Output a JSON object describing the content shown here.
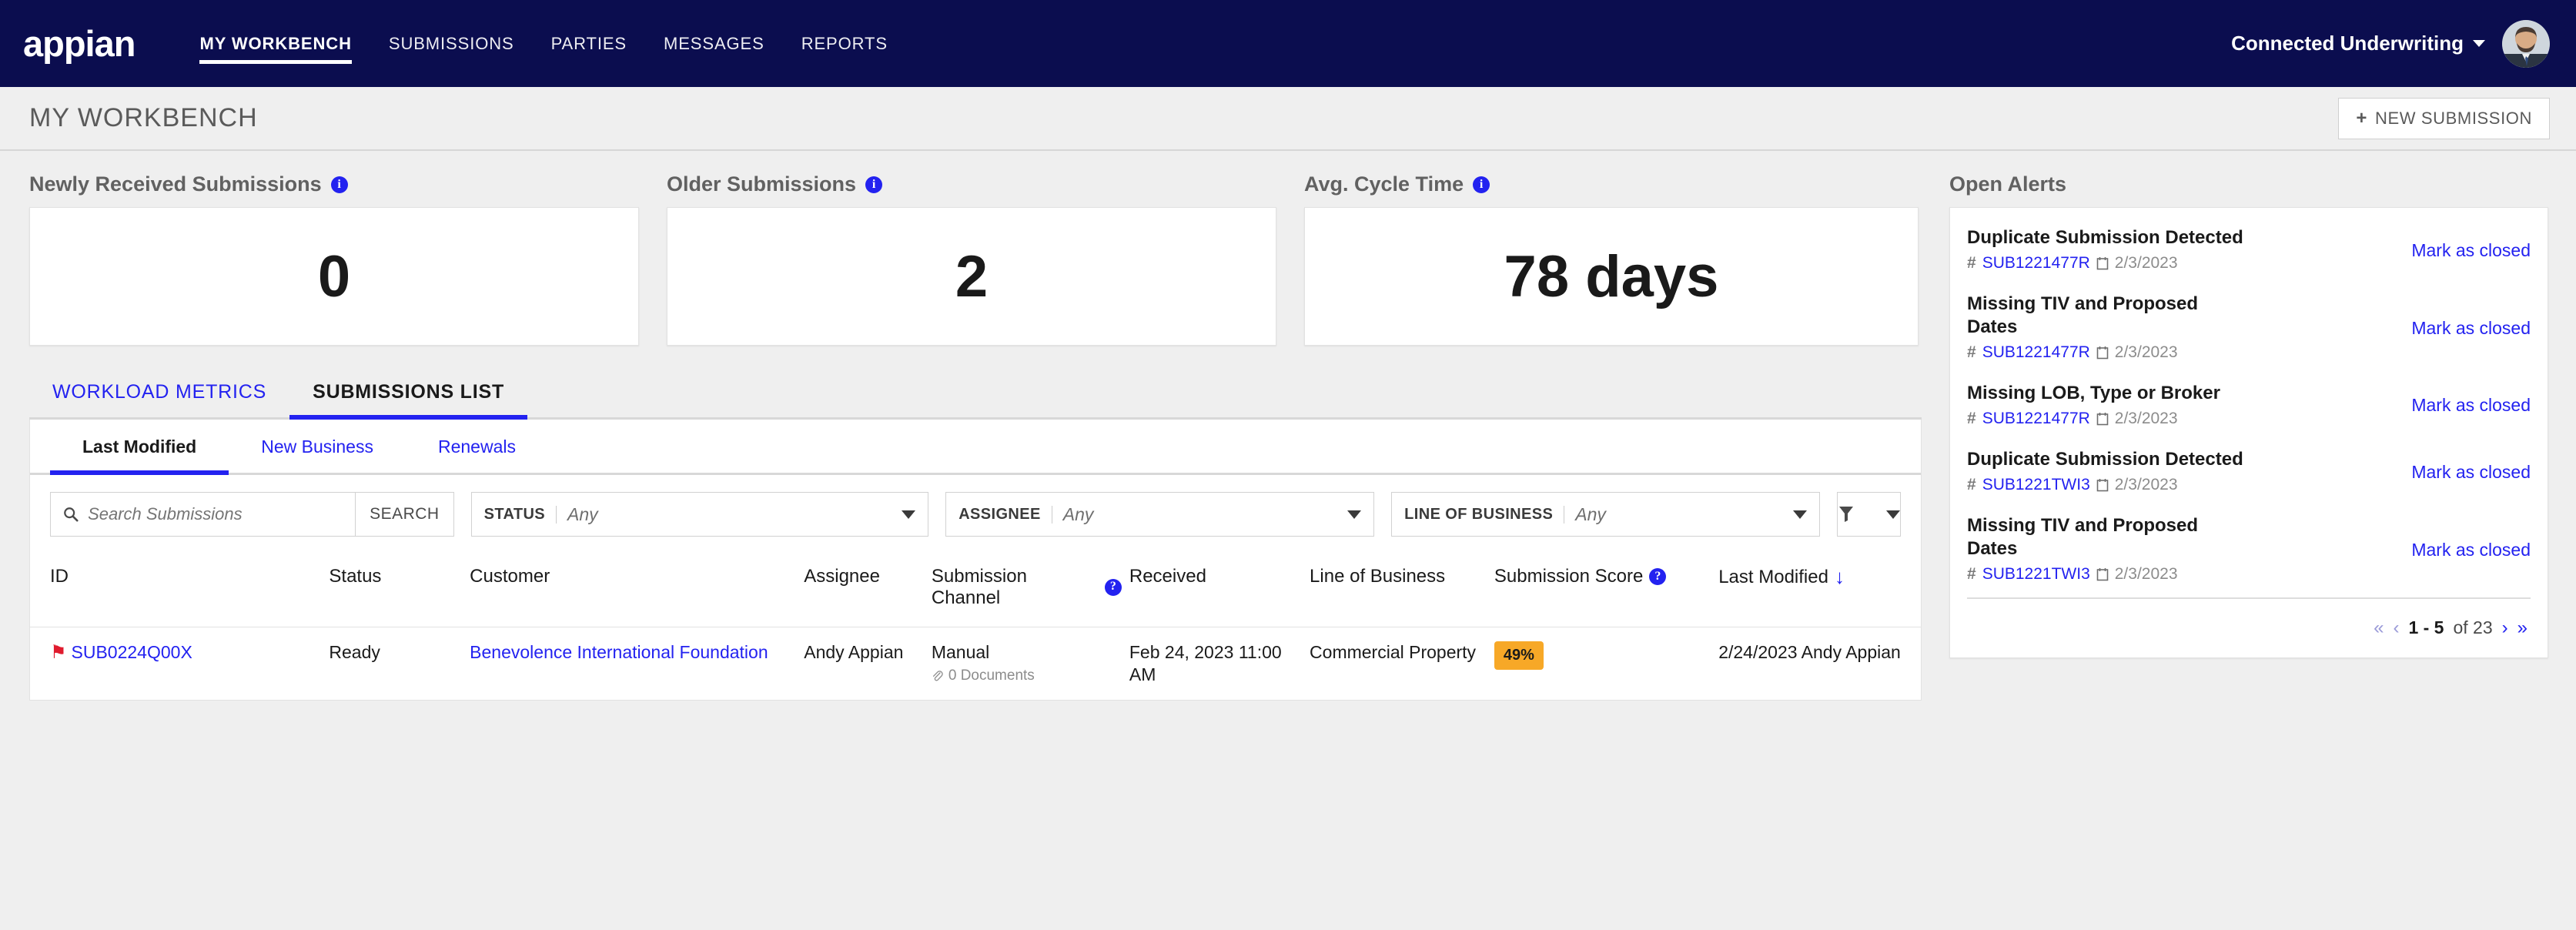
{
  "topnav": {
    "logo": "appian",
    "items": [
      {
        "label": "MY WORKBENCH",
        "active": true
      },
      {
        "label": "SUBMISSIONS",
        "active": false
      },
      {
        "label": "PARTIES",
        "active": false
      },
      {
        "label": "MESSAGES",
        "active": false
      },
      {
        "label": "REPORTS",
        "active": false
      }
    ],
    "org": "Connected Underwriting",
    "brand_color": "#0B0D4F"
  },
  "pagehead": {
    "title": "MY WORKBENCH",
    "new_submission_label": "NEW SUBMISSION",
    "plus": "+"
  },
  "kpis": [
    {
      "label": "Newly Received Submissions",
      "value": "0",
      "info": "i"
    },
    {
      "label": "Older Submissions",
      "value": "2",
      "info": "i"
    },
    {
      "label": "Avg. Cycle Time",
      "value": "78 days",
      "info": "i"
    }
  ],
  "tabs_primary": [
    {
      "label": "WORKLOAD METRICS",
      "active": false
    },
    {
      "label": "SUBMISSIONS LIST",
      "active": true
    }
  ],
  "tabs_secondary": [
    {
      "label": "Last Modified",
      "active": true
    },
    {
      "label": "New Business",
      "active": false
    },
    {
      "label": "Renewals",
      "active": false
    }
  ],
  "filters": {
    "search_placeholder": "Search Submissions",
    "search_value": "",
    "search_button": "SEARCH",
    "status": {
      "label": "STATUS",
      "value": "Any"
    },
    "assignee": {
      "label": "ASSIGNEE",
      "value": "Any"
    },
    "line_of_business": {
      "label": "LINE OF BUSINESS",
      "value": "Any"
    }
  },
  "table": {
    "columns": [
      {
        "label": "ID"
      },
      {
        "label": "Status"
      },
      {
        "label": "Customer"
      },
      {
        "label": "Assignee"
      },
      {
        "label": "Submission Channel",
        "help": "?"
      },
      {
        "label": "Received"
      },
      {
        "label": "Line of Business"
      },
      {
        "label": "Submission Score",
        "help": "?"
      },
      {
        "label": "Last Modified",
        "sort": "↓"
      }
    ],
    "rows": [
      {
        "id": "SUB0224Q00X",
        "flagged": true,
        "status": "Ready",
        "customer": "Benevolence International Foundation",
        "assignee": "Andy Appian",
        "channel": "Manual",
        "documents": "0 Documents",
        "received": "Feb 24, 2023 11:00 AM",
        "line_of_business": "Commercial Property",
        "score": "49%",
        "score_color": "#F7A827",
        "last_modified": "2/24/2023 Andy Appian"
      }
    ]
  },
  "alerts": {
    "title": "Open Alerts",
    "action_label": "Mark as closed",
    "items": [
      {
        "title": "Duplicate Submission Detected",
        "id": "SUB1221477R",
        "date": "2/3/2023"
      },
      {
        "title": "Missing TIV and Proposed Dates",
        "id": "SUB1221477R",
        "date": "2/3/2023"
      },
      {
        "title": "Missing LOB, Type or Broker",
        "id": "SUB1221477R",
        "date": "2/3/2023"
      },
      {
        "title": "Duplicate Submission Detected",
        "id": "SUB1221TWI3",
        "date": "2/3/2023"
      },
      {
        "title": "Missing TIV and Proposed Dates",
        "id": "SUB1221TWI3",
        "date": "2/3/2023"
      }
    ],
    "pager": {
      "first": "«",
      "prev": "‹",
      "range": "1 - 5",
      "of": "of 23",
      "next": "›",
      "last": "»"
    }
  }
}
